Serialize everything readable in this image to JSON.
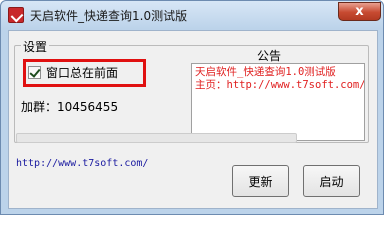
{
  "window": {
    "title": "天启软件_快递查询1.0测试版",
    "close_symbol": "x"
  },
  "settings": {
    "group_title": "设置",
    "always_on_top_label": "窗口总在前面",
    "always_on_top_checked": true,
    "qq_group_label": "加群：10456455"
  },
  "notice": {
    "title": "公告",
    "lines": [
      "天启软件_快递查询1.0测试版",
      "主页：http://www.t7soft.com/"
    ]
  },
  "progress": {
    "value": 0
  },
  "footer": {
    "homepage_url": "http://www.t7soft.com/",
    "update_label": "更新",
    "start_label": "启动"
  },
  "colors": {
    "notice_text": "#e02020",
    "highlight": "#e01010",
    "close_button": "#c74a31"
  }
}
